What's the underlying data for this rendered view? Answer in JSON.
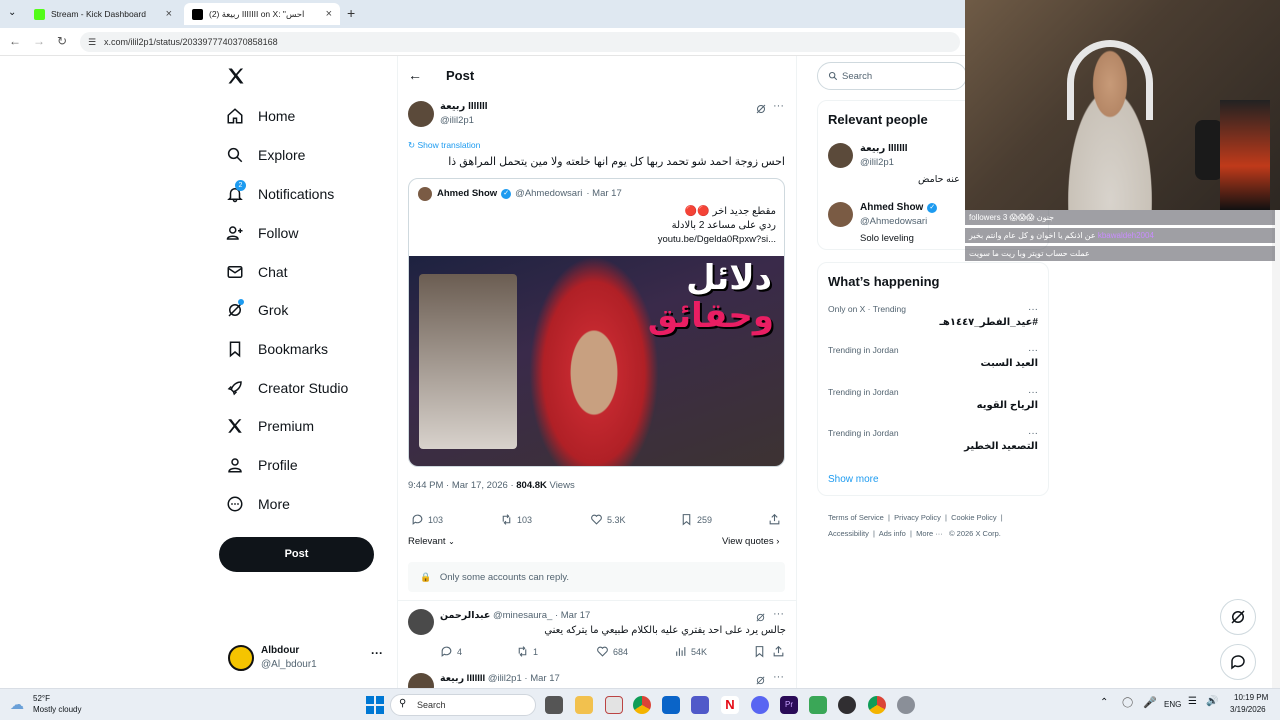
{
  "browser": {
    "tabs": [
      {
        "label": "Stream - Kick Dashboard"
      },
      {
        "label": "(2) ربيعة IIIIIII on X: \"احس"
      }
    ],
    "url": "x.com/ilil2p1/status/2033977740370858168"
  },
  "nav": {
    "items": [
      {
        "label": "Home",
        "icon": "home-icon"
      },
      {
        "label": "Explore",
        "icon": "search-icon"
      },
      {
        "label": "Notifications",
        "icon": "bell-icon",
        "badge": "2"
      },
      {
        "label": "Follow",
        "icon": "follow-icon"
      },
      {
        "label": "Chat",
        "icon": "mail-icon"
      },
      {
        "label": "Grok",
        "icon": "grok-icon"
      },
      {
        "label": "Bookmarks",
        "icon": "bookmark-icon"
      },
      {
        "label": "Creator Studio",
        "icon": "rocket-icon"
      },
      {
        "label": "Premium",
        "icon": "x-logo-icon"
      },
      {
        "label": "Profile",
        "icon": "person-icon"
      },
      {
        "label": "More",
        "icon": "more-circle-icon"
      }
    ],
    "post_button": "Post",
    "account": {
      "name": "Albdour",
      "handle": "@Al_bdour1"
    }
  },
  "header": {
    "title": "Post"
  },
  "post": {
    "author_name": "ربيعة IIIIIII",
    "author_handle": "@ilil2p1",
    "show_translation": "Show translation",
    "text": "احس زوجة احمد شو تحمد ربها كل يوم انها خلعته ولا مين يتحمل المراهق ذا",
    "quote": {
      "name": "Ahmed Show",
      "handle": "@Ahmedowsari",
      "date": "· Mar 17",
      "line1": "مقطع جديد اخر 🔴🔴",
      "line2": "ردي على مساعد 2 بالادلة",
      "link": "youtu.be/Dgelda0Rpxw?si...",
      "thumb_text1": "دلائل",
      "thumb_text2": "وحقائق"
    },
    "timestamp": "9:44 PM · Mar 17, 2026 ·",
    "views_count": "804.8K",
    "views_label": "Views",
    "stats": {
      "replies": "103",
      "reposts": "103",
      "likes": "5.3K",
      "bookmarks": "259"
    },
    "relevant": "Relevant",
    "view_quotes": "View quotes",
    "reply_restriction": "Only some accounts can reply."
  },
  "replies": [
    {
      "name": "عبدالرحمن",
      "handle": "@minesaura_",
      "date": "· Mar 17",
      "text": "جالس يرد على احد يفتري عليه بالكلام طبيعي ما يتركه يعني",
      "stats": {
        "replies": "4",
        "reposts": "1",
        "likes": "684",
        "views": "54K"
      }
    },
    {
      "name": "ربيعة IIIIIII",
      "handle": "@ilil2p1",
      "date": "· Mar 17"
    }
  ],
  "right": {
    "search_placeholder": "Search",
    "relevant_title": "Relevant people",
    "people": [
      {
        "name": "ربيعة IIIIIII",
        "handle": "@ilil2p1",
        "bio": "عنه حامض"
      },
      {
        "name": "Ahmed Show",
        "handle": "@Ahmedowsari",
        "bio": "Solo leveling"
      }
    ],
    "happening_title": "What’s happening",
    "trends": [
      {
        "context": "Only on X · Trending",
        "topic": "#عيد_الفطر_١٤٤٧هـ"
      },
      {
        "context": "Trending in Jordan",
        "topic": "العيد السبت"
      },
      {
        "context": "Trending in Jordan",
        "topic": "الرياح القويه"
      },
      {
        "context": "Trending in Jordan",
        "topic": "التصعيد الخطير"
      }
    ],
    "show_more": "Show more",
    "footer": [
      "Terms of Service",
      "Privacy Policy",
      "Cookie Policy",
      "Accessibility",
      "Ads info",
      "More ···",
      "© 2026 X Corp."
    ]
  },
  "overlay": {
    "chat": [
      {
        "user": "",
        "text": "جنون 😱😱😱 3 followers"
      },
      {
        "user": "kbawaldeh2004",
        "text": "عن اذنكم يا اخوان و كل عام وانتم بخير"
      },
      {
        "user": "",
        "text": "عملت حساب تويتر وبا ريت ما سويت"
      }
    ]
  },
  "taskbar": {
    "weather_temp": "52°F",
    "weather_desc": "Mostly cloudy",
    "search": "Search",
    "lang": "ENG",
    "time": "10:19 PM",
    "date": "3/19/2026"
  },
  "colors": {
    "accent": "#1d9bf0",
    "text": "#0f1419",
    "muted": "#536471",
    "kick_green": "#53fc18"
  }
}
